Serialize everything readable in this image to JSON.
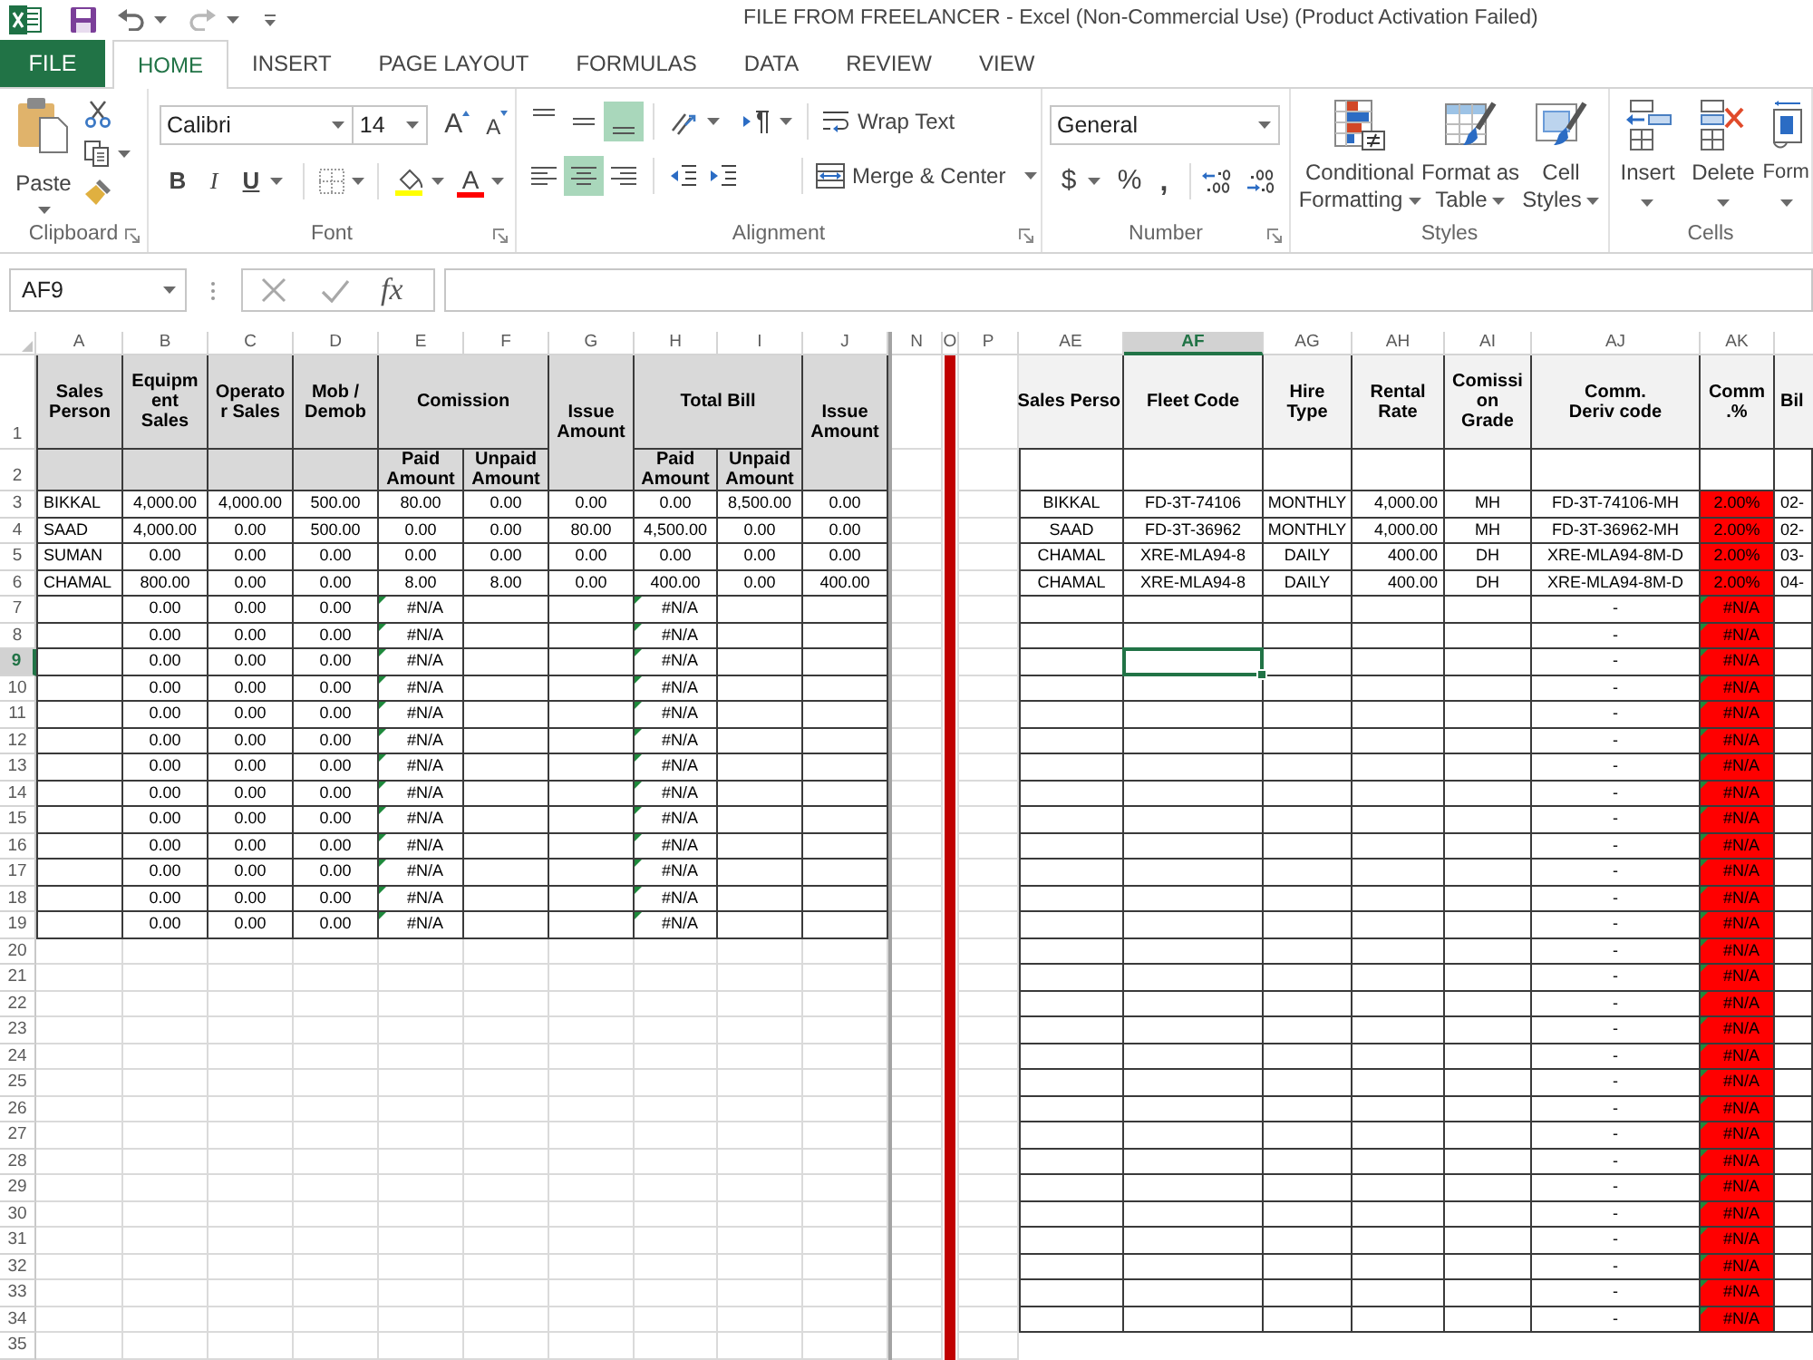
{
  "window": {
    "title": "FILE FROM FREELANCER - Excel (Non-Commercial Use) (Product Activation Failed)"
  },
  "quick_access": [
    {
      "kind": "save"
    },
    {
      "kind": "undo",
      "disabled": false
    },
    {
      "kind": "redo",
      "disabled": true
    }
  ],
  "tabs": [
    {
      "kind": "file",
      "label": "FILE",
      "selected": false
    },
    {
      "kind": "tab",
      "label": "HOME",
      "selected": true
    },
    {
      "kind": "tab",
      "label": "INSERT",
      "selected": false
    },
    {
      "kind": "tab",
      "label": "PAGE LAYOUT",
      "selected": false
    },
    {
      "kind": "tab",
      "label": "FORMULAS",
      "selected": false
    },
    {
      "kind": "tab",
      "label": "DATA",
      "selected": false
    },
    {
      "kind": "tab",
      "label": "REVIEW",
      "selected": false
    },
    {
      "kind": "tab",
      "label": "VIEW",
      "selected": false
    }
  ],
  "ribbon": {
    "clipboard": {
      "label": "Clipboard",
      "launcher": true,
      "paste": "Paste"
    },
    "font": {
      "label": "Font",
      "launcher": true,
      "font_name": "Calibri",
      "font_size": "14",
      "size_buttons": [
        {
          "kind": "grow",
          "label": "A"
        },
        {
          "kind": "shrink",
          "label": "A"
        }
      ],
      "style_buttons": [
        {
          "kind": "bold",
          "label": "B"
        },
        {
          "kind": "italic",
          "label": "I"
        },
        {
          "kind": "underline",
          "label": "U"
        }
      ],
      "color_buttons": [
        {
          "kind": "fill",
          "color": "#ffff00"
        },
        {
          "kind": "font",
          "label": "A",
          "color": "#ff0000"
        }
      ]
    },
    "alignment": {
      "label": "Alignment",
      "launcher": true,
      "vertical": [
        {
          "kind": "top",
          "on": false
        },
        {
          "kind": "middle",
          "on": false
        },
        {
          "kind": "bottom",
          "on": true
        }
      ],
      "horizontal": [
        {
          "kind": "left",
          "on": false
        },
        {
          "kind": "center",
          "on": true
        },
        {
          "kind": "right",
          "on": false
        }
      ],
      "wrap_text": "Wrap Text",
      "merge": "Merge & Center"
    },
    "number": {
      "label": "Number",
      "launcher": true,
      "format": "General",
      "buttons": [
        {
          "kind": "currency",
          "label": "$"
        },
        {
          "kind": "percent",
          "label": "%"
        },
        {
          "kind": "comma",
          "label": ","
        }
      ]
    },
    "styles": {
      "label": "Styles",
      "launcher": false,
      "buttons": [
        {
          "kind": "conditional",
          "lines": [
            "Conditional",
            "Formatting"
          ]
        },
        {
          "kind": "table",
          "lines": [
            "Format as",
            "Table"
          ]
        },
        {
          "kind": "cell",
          "lines": [
            "Cell",
            "Styles"
          ]
        }
      ]
    },
    "cells": {
      "label": "Cells",
      "launcher": false,
      "buttons": [
        {
          "kind": "insert",
          "label": "Insert"
        },
        {
          "kind": "delete",
          "label": "Delete"
        },
        {
          "kind": "format",
          "label": "Form"
        }
      ]
    }
  },
  "formula_bar": {
    "name_box": "AF9",
    "function_label": "fx"
  },
  "columns_left": [
    {
      "label": "A",
      "selected": false
    },
    {
      "label": "B",
      "selected": false
    },
    {
      "label": "C",
      "selected": false
    },
    {
      "label": "D",
      "selected": false
    },
    {
      "label": "E",
      "selected": false
    },
    {
      "label": "F",
      "selected": false
    },
    {
      "label": "G",
      "selected": false
    },
    {
      "label": "H",
      "selected": false
    },
    {
      "label": "I",
      "selected": false
    },
    {
      "label": "J",
      "selected": false
    }
  ],
  "columns_right": [
    {
      "label": "N",
      "selected": false
    },
    {
      "label": "O",
      "selected": false,
      "color": "#c00000"
    },
    {
      "label": "P",
      "selected": false
    },
    {
      "label": "AE",
      "selected": false
    },
    {
      "label": "AF",
      "selected": true
    },
    {
      "label": "AG",
      "selected": false
    },
    {
      "label": "AH",
      "selected": false
    },
    {
      "label": "AI",
      "selected": false
    },
    {
      "label": "AJ",
      "selected": false
    },
    {
      "label": "AK",
      "selected": false
    },
    {
      "selected": false
    }
  ],
  "row_headers": [
    {
      "label": "1",
      "selected": false
    },
    {
      "label": "2",
      "selected": false
    },
    {
      "label": "3",
      "selected": false
    },
    {
      "label": "4",
      "selected": false
    },
    {
      "label": "5",
      "selected": false
    },
    {
      "label": "6",
      "selected": false
    },
    {
      "label": "7",
      "selected": false
    },
    {
      "label": "8",
      "selected": false
    },
    {
      "label": "9",
      "selected": true
    },
    {
      "label": "10",
      "selected": false
    },
    {
      "label": "11",
      "selected": false
    },
    {
      "label": "12",
      "selected": false
    },
    {
      "label": "13",
      "selected": false
    },
    {
      "label": "14",
      "selected": false
    },
    {
      "label": "15",
      "selected": false
    },
    {
      "label": "16",
      "selected": false
    },
    {
      "label": "17",
      "selected": false
    },
    {
      "label": "18",
      "selected": false
    },
    {
      "label": "19",
      "selected": false
    },
    {
      "label": "20",
      "selected": false
    },
    {
      "label": "21",
      "selected": false
    },
    {
      "label": "22",
      "selected": false
    },
    {
      "label": "23",
      "selected": false
    },
    {
      "label": "24",
      "selected": false
    },
    {
      "label": "25",
      "selected": false
    },
    {
      "label": "26",
      "selected": false
    },
    {
      "label": "27",
      "selected": false
    },
    {
      "label": "28",
      "selected": false
    },
    {
      "label": "29",
      "selected": false
    },
    {
      "label": "30",
      "selected": false
    },
    {
      "label": "31",
      "selected": false
    },
    {
      "label": "32",
      "selected": false
    },
    {
      "label": "33",
      "selected": false
    },
    {
      "label": "34",
      "selected": false
    },
    {
      "label": "35",
      "selected": false
    }
  ],
  "left_table": {
    "header": [
      {
        "kind": "single",
        "label": "Sales Person"
      },
      {
        "kind": "single",
        "label": "Equipment Sales"
      },
      {
        "kind": "single",
        "label": "Operator Sales"
      },
      {
        "kind": "single",
        "label": "Mob / Demob"
      },
      {
        "kind": "group",
        "label": "Comission",
        "sub": [
          "Paid Amount",
          "Unpaid Amount"
        ]
      },
      {
        "kind": "tall",
        "label": "Issue Amount"
      },
      {
        "kind": "group",
        "label": "Total Bill",
        "sub": [
          "Paid Amount",
          "Unpaid Amount"
        ]
      },
      {
        "kind": "tall",
        "label": "Issue Amount"
      }
    ],
    "rows": [
      [
        "BIKKAL",
        "4,000.00",
        "4,000.00",
        "500.00",
        "80.00",
        "0.00",
        "0.00",
        "0.00",
        "8,500.00",
        "0.00"
      ],
      [
        "SAAD",
        "4,000.00",
        "0.00",
        "500.00",
        "0.00",
        "0.00",
        "80.00",
        "4,500.00",
        "0.00",
        "0.00"
      ],
      [
        "SUMAN",
        "0.00",
        "0.00",
        "0.00",
        "0.00",
        "0.00",
        "0.00",
        "0.00",
        "0.00",
        "0.00"
      ],
      [
        "CHAMAL",
        "800.00",
        "0.00",
        "0.00",
        "8.00",
        "8.00",
        "0.00",
        "400.00",
        "0.00",
        "400.00"
      ],
      [
        null,
        "0.00",
        "0.00",
        "0.00",
        {
          "text": "#N/A",
          "error": true
        },
        null,
        null,
        {
          "text": "#N/A",
          "error": true
        },
        null,
        null
      ],
      [
        null,
        "0.00",
        "0.00",
        "0.00",
        {
          "text": "#N/A",
          "error": true
        },
        null,
        null,
        {
          "text": "#N/A",
          "error": true
        },
        null,
        null
      ],
      [
        null,
        "0.00",
        "0.00",
        "0.00",
        {
          "text": "#N/A",
          "error": true
        },
        null,
        null,
        {
          "text": "#N/A",
          "error": true
        },
        null,
        null
      ],
      [
        null,
        "0.00",
        "0.00",
        "0.00",
        {
          "text": "#N/A",
          "error": true
        },
        null,
        null,
        {
          "text": "#N/A",
          "error": true
        },
        null,
        null
      ],
      [
        null,
        "0.00",
        "0.00",
        "0.00",
        {
          "text": "#N/A",
          "error": true
        },
        null,
        null,
        {
          "text": "#N/A",
          "error": true
        },
        null,
        null
      ],
      [
        null,
        "0.00",
        "0.00",
        "0.00",
        {
          "text": "#N/A",
          "error": true
        },
        null,
        null,
        {
          "text": "#N/A",
          "error": true
        },
        null,
        null
      ],
      [
        null,
        "0.00",
        "0.00",
        "0.00",
        {
          "text": "#N/A",
          "error": true
        },
        null,
        null,
        {
          "text": "#N/A",
          "error": true
        },
        null,
        null
      ],
      [
        null,
        "0.00",
        "0.00",
        "0.00",
        {
          "text": "#N/A",
          "error": true
        },
        null,
        null,
        {
          "text": "#N/A",
          "error": true
        },
        null,
        null
      ],
      [
        null,
        "0.00",
        "0.00",
        "0.00",
        {
          "text": "#N/A",
          "error": true
        },
        null,
        null,
        {
          "text": "#N/A",
          "error": true
        },
        null,
        null
      ],
      [
        null,
        "0.00",
        "0.00",
        "0.00",
        {
          "text": "#N/A",
          "error": true
        },
        null,
        null,
        {
          "text": "#N/A",
          "error": true
        },
        null,
        null
      ],
      [
        null,
        "0.00",
        "0.00",
        "0.00",
        {
          "text": "#N/A",
          "error": true
        },
        null,
        null,
        {
          "text": "#N/A",
          "error": true
        },
        null,
        null
      ],
      [
        null,
        "0.00",
        "0.00",
        "0.00",
        {
          "text": "#N/A",
          "error": true
        },
        null,
        null,
        {
          "text": "#N/A",
          "error": true
        },
        null,
        null
      ],
      [
        null,
        "0.00",
        "0.00",
        "0.00",
        {
          "text": "#N/A",
          "error": true
        },
        null,
        null,
        {
          "text": "#N/A",
          "error": true
        },
        null,
        null
      ]
    ]
  },
  "right_table": {
    "header": [
      {
        "label": "Sales Perso"
      },
      {
        "label": "Fleet Code"
      },
      {
        "label": "Hire Type"
      },
      {
        "label": "Rental Rate"
      },
      {
        "label": "Comission Grade"
      },
      {
        "label": "Comm. Deriv code"
      },
      {
        "label": "Comm .%"
      },
      {
        "label": "Bil"
      }
    ],
    "rows": [
      [
        null,
        null,
        null,
        null,
        null,
        null,
        null,
        null
      ],
      [
        "BIKKAL",
        "FD-3T-74106",
        "MONTHLY",
        "4,000.00",
        "MH",
        "FD-3T-74106-MH",
        {
          "text": "2.00%",
          "color": "#ff0000",
          "error": false
        },
        "02-"
      ],
      [
        "SAAD",
        "FD-3T-36962",
        "MONTHLY",
        "4,000.00",
        "MH",
        "FD-3T-36962-MH",
        {
          "text": "2.00%",
          "color": "#ff0000",
          "error": false
        },
        "02-"
      ],
      [
        "CHAMAL",
        "XRE-MLA94-8",
        "DAILY",
        "400.00",
        "DH",
        "XRE-MLA94-8M-D",
        {
          "text": "2.00%",
          "color": "#ff0000",
          "error": false
        },
        "03-"
      ],
      [
        "CHAMAL",
        "XRE-MLA94-8",
        "DAILY",
        "400.00",
        "DH",
        "XRE-MLA94-8M-D",
        {
          "text": "2.00%",
          "color": "#ff0000",
          "error": false
        },
        "04-"
      ],
      [
        null,
        null,
        null,
        null,
        null,
        "-",
        {
          "text": "#N/A",
          "color": "#ff0000",
          "error": true
        },
        null
      ],
      [
        null,
        null,
        null,
        null,
        null,
        "-",
        {
          "text": "#N/A",
          "color": "#ff0000",
          "error": true
        },
        null
      ],
      [
        null,
        null,
        null,
        null,
        null,
        "-",
        {
          "text": "#N/A",
          "color": "#ff0000",
          "error": true
        },
        null
      ],
      [
        null,
        null,
        null,
        null,
        null,
        "-",
        {
          "text": "#N/A",
          "color": "#ff0000",
          "error": true
        },
        null
      ],
      [
        null,
        null,
        null,
        null,
        null,
        "-",
        {
          "text": "#N/A",
          "color": "#ff0000",
          "error": true
        },
        null
      ],
      [
        null,
        null,
        null,
        null,
        null,
        "-",
        {
          "text": "#N/A",
          "color": "#ff0000",
          "error": true
        },
        null
      ],
      [
        null,
        null,
        null,
        null,
        null,
        "-",
        {
          "text": "#N/A",
          "color": "#ff0000",
          "error": true
        },
        null
      ],
      [
        null,
        null,
        null,
        null,
        null,
        "-",
        {
          "text": "#N/A",
          "color": "#ff0000",
          "error": true
        },
        null
      ],
      [
        null,
        null,
        null,
        null,
        null,
        "-",
        {
          "text": "#N/A",
          "color": "#ff0000",
          "error": true
        },
        null
      ],
      [
        null,
        null,
        null,
        null,
        null,
        "-",
        {
          "text": "#N/A",
          "color": "#ff0000",
          "error": true
        },
        null
      ],
      [
        null,
        null,
        null,
        null,
        null,
        "-",
        {
          "text": "#N/A",
          "color": "#ff0000",
          "error": true
        },
        null
      ],
      [
        null,
        null,
        null,
        null,
        null,
        "-",
        {
          "text": "#N/A",
          "color": "#ff0000",
          "error": true
        },
        null
      ],
      [
        null,
        null,
        null,
        null,
        null,
        "-",
        {
          "text": "#N/A",
          "color": "#ff0000",
          "error": true
        },
        null
      ],
      [
        null,
        null,
        null,
        null,
        null,
        "-",
        {
          "text": "#N/A",
          "color": "#ff0000",
          "error": true
        },
        null
      ],
      [
        null,
        null,
        null,
        null,
        null,
        "-",
        {
          "text": "#N/A",
          "color": "#ff0000",
          "error": true
        },
        null
      ],
      [
        null,
        null,
        null,
        null,
        null,
        "-",
        {
          "text": "#N/A",
          "color": "#ff0000",
          "error": true
        },
        null
      ],
      [
        null,
        null,
        null,
        null,
        null,
        "-",
        {
          "text": "#N/A",
          "color": "#ff0000",
          "error": true
        },
        null
      ],
      [
        null,
        null,
        null,
        null,
        null,
        "-",
        {
          "text": "#N/A",
          "color": "#ff0000",
          "error": true
        },
        null
      ],
      [
        null,
        null,
        null,
        null,
        null,
        "-",
        {
          "text": "#N/A",
          "color": "#ff0000",
          "error": true
        },
        null
      ],
      [
        null,
        null,
        null,
        null,
        null,
        "-",
        {
          "text": "#N/A",
          "color": "#ff0000",
          "error": true
        },
        null
      ],
      [
        null,
        null,
        null,
        null,
        null,
        "-",
        {
          "text": "#N/A",
          "color": "#ff0000",
          "error": true
        },
        null
      ],
      [
        null,
        null,
        null,
        null,
        null,
        "-",
        {
          "text": "#N/A",
          "color": "#ff0000",
          "error": true
        },
        null
      ],
      [
        null,
        null,
        null,
        null,
        null,
        "-",
        {
          "text": "#N/A",
          "color": "#ff0000",
          "error": true
        },
        null
      ],
      [
        null,
        null,
        null,
        null,
        null,
        "-",
        {
          "text": "#N/A",
          "color": "#ff0000",
          "error": true
        },
        null
      ],
      [
        null,
        null,
        null,
        null,
        null,
        "-",
        {
          "text": "#N/A",
          "color": "#ff0000",
          "error": true
        },
        null
      ],
      [
        null,
        null,
        null,
        null,
        null,
        "-",
        {
          "text": "#N/A",
          "color": "#ff0000",
          "error": true
        },
        null
      ],
      [
        null,
        null,
        null,
        null,
        null,
        "-",
        {
          "text": "#N/A",
          "color": "#ff0000",
          "error": true
        },
        null
      ],
      [
        null,
        null,
        null,
        null,
        null,
        "-",
        {
          "text": "#N/A",
          "color": "#ff0000",
          "error": true
        },
        null
      ]
    ]
  }
}
